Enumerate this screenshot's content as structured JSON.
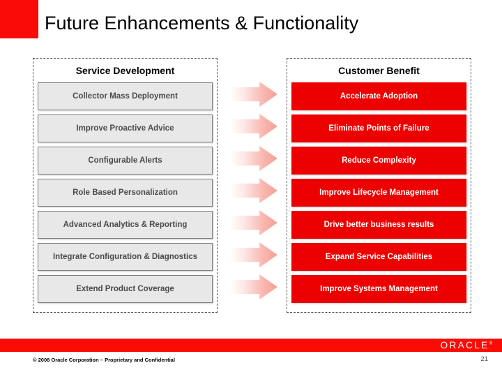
{
  "slide": {
    "title": "Future Enhancements & Functionality",
    "accent_color": "#fb0b06",
    "left_box_color": "#e8e8e8",
    "right_box_color": "#ed0000"
  },
  "left_column": {
    "header": "Service Development",
    "items": [
      "Collector Mass Deployment",
      "Improve Proactive Advice",
      "Configurable Alerts",
      "Role Based Personalization",
      "Advanced Analytics & Reporting",
      "Integrate Configuration & Diagnostics",
      "Extend Product Coverage"
    ]
  },
  "right_column": {
    "header": "Customer Benefit",
    "items": [
      "Accelerate Adoption",
      "Eliminate Points of Failure",
      "Reduce Complexity",
      "Improve Lifecycle Management",
      "Drive better business results",
      "Expand Service Capabilities",
      "Improve Systems Management"
    ]
  },
  "arrows": {
    "count": 7,
    "icon": "arrow-right-icon"
  },
  "footer": {
    "logo": "ORACLE",
    "logo_tm": "®",
    "copyright": "© 2008 Oracle Corporation – Proprietary and Confidential",
    "page_number": "21"
  }
}
